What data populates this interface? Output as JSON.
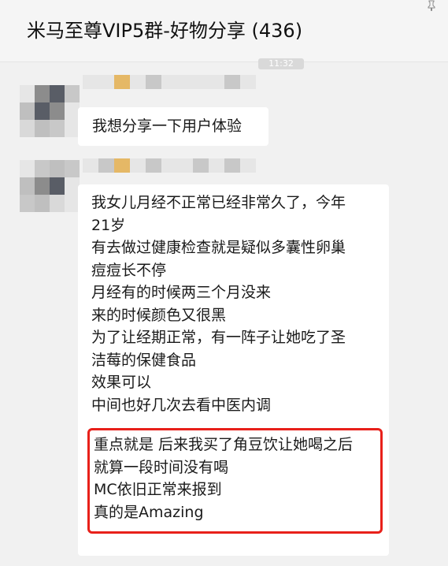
{
  "header": {
    "title": "米马至尊VIP5群-好物分享 (436)",
    "pin_icon": "pin-icon"
  },
  "timestamp": "11:32",
  "messages": [
    {
      "text_lines": [
        "我想分享一下用户体验"
      ]
    },
    {
      "text_lines": [
        "我女儿月经不正常已经非常久了，今年",
        "21岁",
        "有去做过健康检查就是疑似多囊性卵巢",
        "痘痘长不停",
        "月经有的时候两三个月没来",
        "来的时候颜色又很黑",
        "为了让经期正常，有一阵子让她吃了圣",
        "洁莓的保健食品",
        "效果可以",
        "中间也好几次去看中医内调"
      ],
      "highlight_lines": [
        "重点就是 后来我买了角豆饮让她喝之后",
        "就算一段时间没有喝",
        "MC依旧正常来报到",
        "真的是Amazing"
      ]
    }
  ],
  "colors": {
    "background": "#f1f1f1",
    "bubble": "#ffffff",
    "highlight_border": "#e8201a",
    "avatar_cell_colors": [
      "#d9d9d9",
      "#bfbfbf",
      "#8c8c8c",
      "#595d66",
      "#e6e6e6",
      "#c8c8c8",
      "#e5b866"
    ]
  }
}
